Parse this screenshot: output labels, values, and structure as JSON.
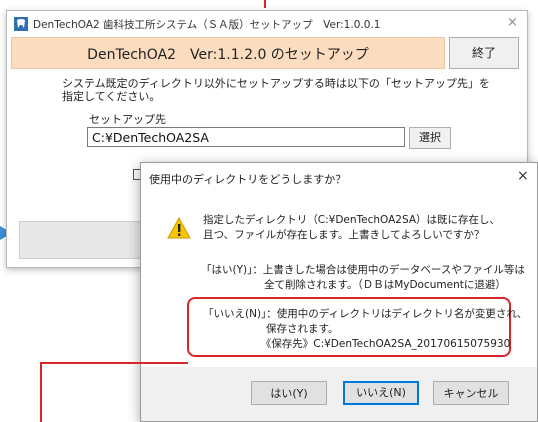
{
  "main_window": {
    "title": "DenTechOA2 歯科技工所システム（ＳＡ版）セットアップ　Ver:1.0.0.1",
    "close_label": "×",
    "banner": "DenTechOA2　Ver:1.1.2.0 のセットアップ",
    "exit_label": "終了",
    "instruction_line1": "システム既定のディレクトリ以外にセットアップする時は以下の「セットアップ先」を",
    "instruction_line2": "指定してください。",
    "dest_label": "セットアップ先",
    "dest_value": "C:¥DenTechOA2SA",
    "select_label": "選択"
  },
  "dialog": {
    "title": "使用中のディレクトリをどうしますか？",
    "close_label": "×",
    "message1_line1": "指定したディレクトリ（C:¥DenTechOA2SA）は既に存在し、",
    "message1_line2": "且つ、ファイルが存在します。上書きしてよろしいですか？",
    "message2_line1": "「はい(Y)」：上書きした場合は使用中のデータベースやファイル等は",
    "message2_line2": "　　　　　　全て削除されます。（ＤＢはMyDocumentに退避）",
    "message3_line1": "「いいえ(N)」：使用中のディレクトリはディレクトリ名が変更され、",
    "message3_line2": "　　　　　　保存されます。",
    "message3_line3": "　　　　　　《保存先》C:¥DenTechOA2SA_20170615075930",
    "yes_label": "はい(Y)",
    "no_label": "いいえ(N)",
    "cancel_label": "キャンセル"
  },
  "colors": {
    "banner": "#fbdcbf",
    "highlight": "#d8262b",
    "default_button_border": "#0078d7",
    "arrow": "#3b8fd8"
  },
  "icons": {
    "app": "tooth-app-icon",
    "warning": "warning-icon"
  }
}
